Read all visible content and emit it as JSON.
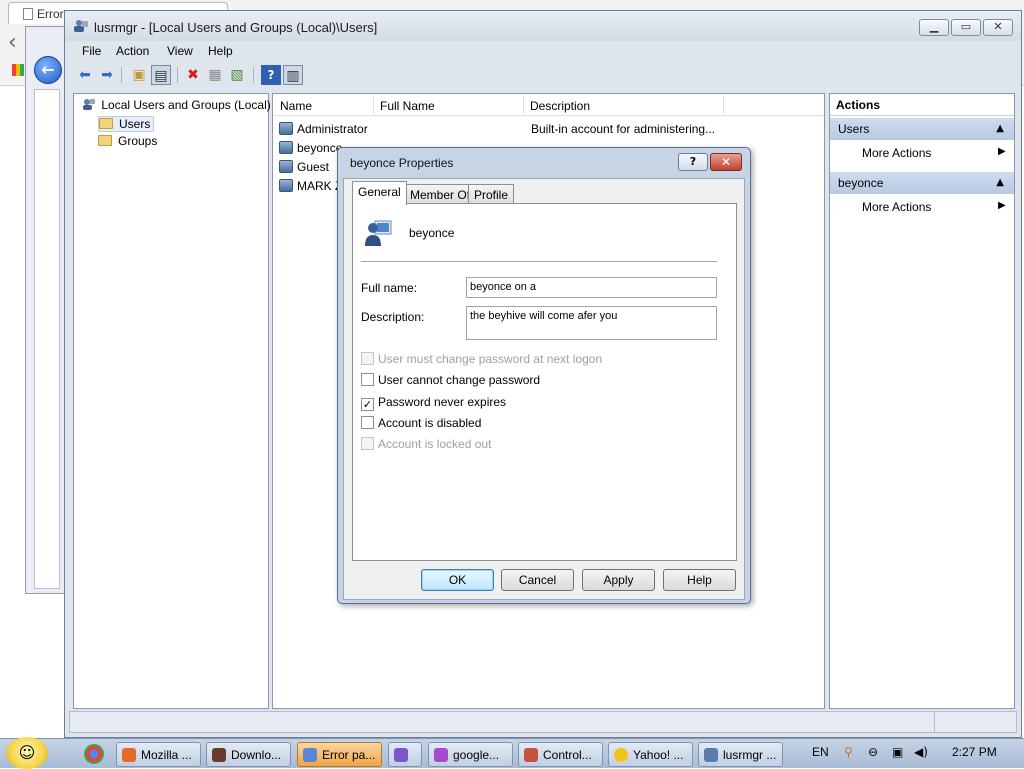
{
  "browser_bg": {
    "tab_title": "Error"
  },
  "mmc": {
    "title": "lusrmgr - [Local Users and Groups (Local)\\Users]",
    "menu": [
      "File",
      "Action",
      "View",
      "Help"
    ],
    "tree": {
      "root": "Local Users and Groups (Local)",
      "children": [
        "Users",
        "Groups"
      ]
    },
    "list": {
      "headers": [
        "Name",
        "Full Name",
        "Description"
      ],
      "rows": [
        {
          "name": "Administrator",
          "description": "Built-in account for administering..."
        },
        {
          "name": "beyonce"
        },
        {
          "name": "Guest"
        },
        {
          "name": "MARK Z"
        }
      ]
    },
    "actions": {
      "header": "Actions",
      "sections": [
        {
          "title": "Users",
          "item": "More Actions"
        },
        {
          "title": "beyonce",
          "item": "More Actions"
        }
      ]
    }
  },
  "dialog": {
    "title": "beyonce Properties",
    "tabs": [
      "General",
      "Member Of",
      "Profile"
    ],
    "user_name": "beyonce",
    "full_name_label": "Full name:",
    "full_name_value": "beyonce on a",
    "description_label": "Description:",
    "description_value": "the beyhive will come afer you",
    "checkboxes": [
      {
        "label": "User must change password at next logon",
        "checked": false,
        "enabled": false
      },
      {
        "label": "User cannot change password",
        "checked": false,
        "enabled": true
      },
      {
        "label": "Password never expires",
        "checked": true,
        "enabled": true
      },
      {
        "label": "Account is disabled",
        "checked": false,
        "enabled": true
      },
      {
        "label": "Account is locked out",
        "checked": false,
        "enabled": false
      }
    ],
    "buttons": {
      "ok": "OK",
      "cancel": "Cancel",
      "apply": "Apply",
      "help": "Help"
    }
  },
  "taskbar": {
    "items": [
      "Mozilla ...",
      "Downlo...",
      "Error pa...",
      "google...",
      "Control...",
      "Yahoo! ...",
      "lusrmgr ..."
    ],
    "language": "EN",
    "clock": "2:27 PM"
  },
  "colors": {
    "accent": "#b7c9e2",
    "dialog_frame": "#c7d4e6",
    "close_red": "#c0422f"
  }
}
